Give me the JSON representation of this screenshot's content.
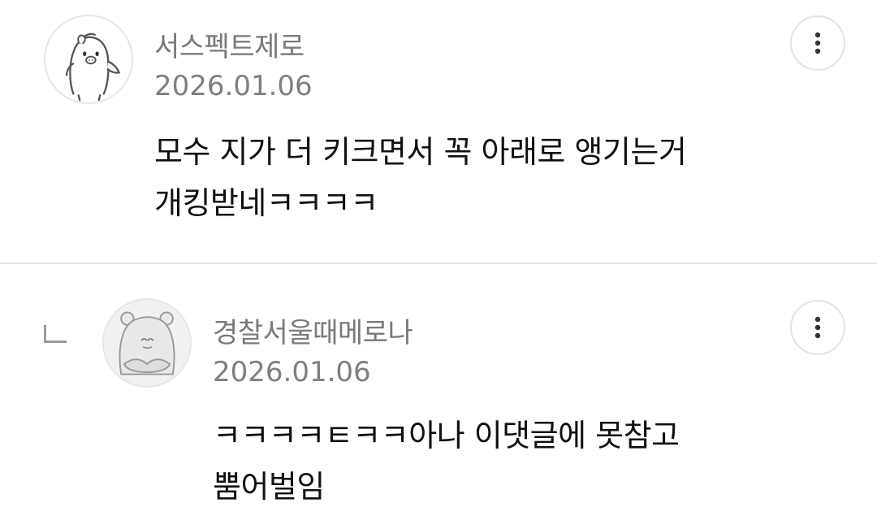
{
  "comments": [
    {
      "author": "서스펙트제로",
      "date": "2026.01.06",
      "text_lines": [
        "모수 지가 더 키크면서 꼭 아래로 앵기는거",
        "개킹받네ㅋㅋㅋㅋ"
      ],
      "avatar_icon": "penguin-character-icon",
      "more_icon": "more-vertical-icon"
    },
    {
      "author": "경찰서울때메로나",
      "date": "2026.01.06",
      "text_lines": [
        "ㅋㅋㅋㅋㅌㅋㅋ아나 이댓글에 못참고",
        "뿜어벌임"
      ],
      "avatar_icon": "bear-character-icon",
      "reply_icon": "reply-corner-icon",
      "more_icon": "more-vertical-icon"
    }
  ],
  "colors": {
    "background": "#ffffff",
    "meta_text": "#7a7a7a",
    "body_text": "#111111",
    "divider": "#e4e4e4"
  }
}
